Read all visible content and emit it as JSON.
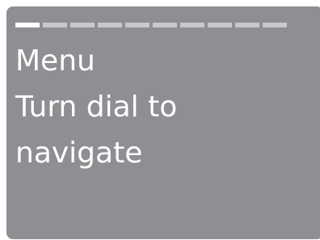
{
  "screen": {
    "menu_title": "Menu",
    "instruction_line1": "Turn dial to",
    "instruction_line2": "navigate"
  },
  "progress": {
    "total_segments": 10,
    "active_segment": 1
  },
  "colors": {
    "screen_bg": "#8f8f93",
    "text": "#ffffff",
    "segment_active": "#ffffff",
    "segment_inactive": "#c9c9cc"
  }
}
